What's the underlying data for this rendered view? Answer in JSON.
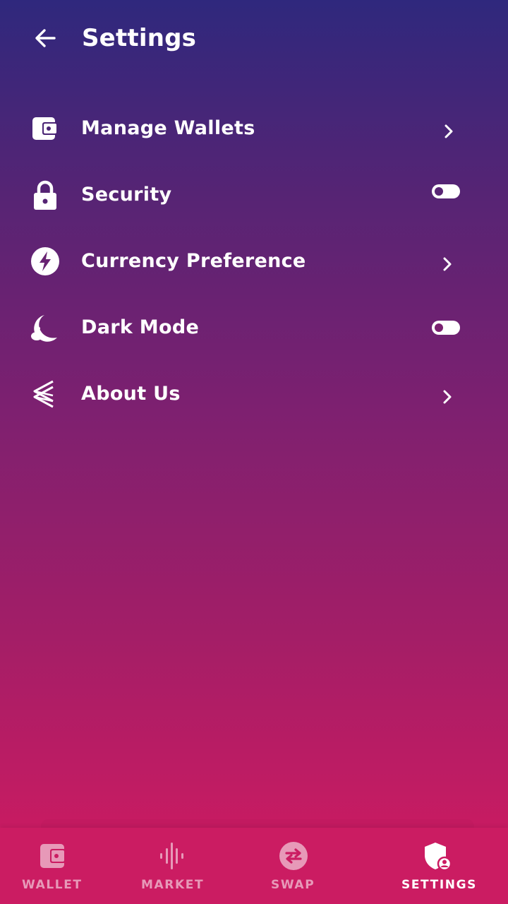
{
  "header": {
    "title": "Settings",
    "back_icon": "arrow-left-icon"
  },
  "menu": [
    {
      "label": "Manage Wallets",
      "icon": "wallet-icon",
      "control": "chevron"
    },
    {
      "label": "Security",
      "icon": "lock-icon",
      "control": "toggle",
      "toggle_on": false
    },
    {
      "label": "Currency Preference",
      "icon": "lightning-icon",
      "control": "chevron"
    },
    {
      "label": "Dark Mode",
      "icon": "moon-icon",
      "control": "toggle",
      "toggle_on": false
    },
    {
      "label": "About Us",
      "icon": "layers-logo-icon",
      "control": "chevron"
    }
  ],
  "bottom_nav": [
    {
      "label": "WALLET",
      "icon": "wallet-icon",
      "active": false
    },
    {
      "label": "MARKET",
      "icon": "sound-wave-icon",
      "active": false
    },
    {
      "label": "SWAP",
      "icon": "swap-arrows-icon",
      "active": false
    },
    {
      "label": "SETTINGS",
      "icon": "shield-user-icon",
      "active": true
    }
  ],
  "colors": {
    "gradient_top": "#2f287d",
    "gradient_bottom": "#cc1b60",
    "nav_background": "#cb1c62",
    "text": "#ffffff"
  }
}
